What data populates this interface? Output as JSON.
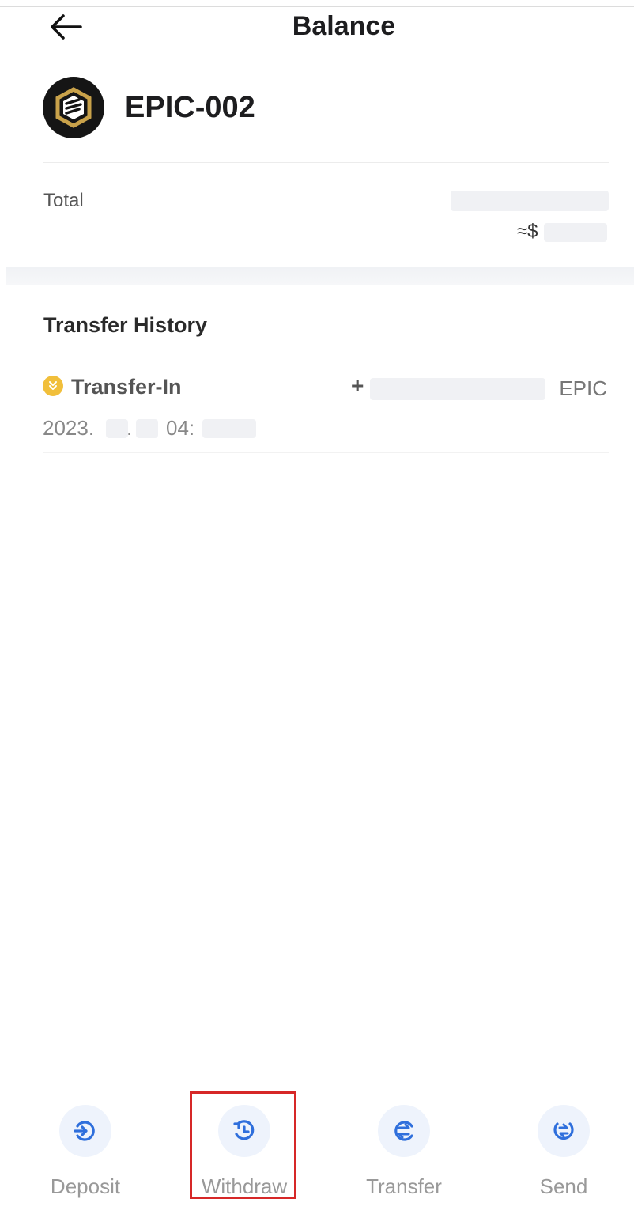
{
  "header": {
    "title": "Balance",
    "back_icon": "arrow-left-icon"
  },
  "coin": {
    "name": "EPIC-002",
    "logo_icon": "epic-coin-logo-icon"
  },
  "total": {
    "label": "Total",
    "approx_prefix": "≈$"
  },
  "history": {
    "title": "Transfer History",
    "transactions": [
      {
        "type": "Transfer-In",
        "sign": "+",
        "unit": "EPIC",
        "date_year": "2023.",
        "date_sep": ".",
        "time_prefix": "04:",
        "icon": "transfer-in-icon"
      }
    ]
  },
  "actions": [
    {
      "label": "Deposit",
      "icon": "deposit-icon"
    },
    {
      "label": "Withdraw",
      "icon": "withdraw-icon"
    },
    {
      "label": "Transfer",
      "icon": "transfer-icon"
    },
    {
      "label": "Send",
      "icon": "send-icon"
    }
  ],
  "colors": {
    "accent_blue": "#2f6fdc",
    "coin_gold": "#c9a24a",
    "transfer_in_yellow": "#f1bf3b",
    "highlight_red": "#d62828"
  }
}
